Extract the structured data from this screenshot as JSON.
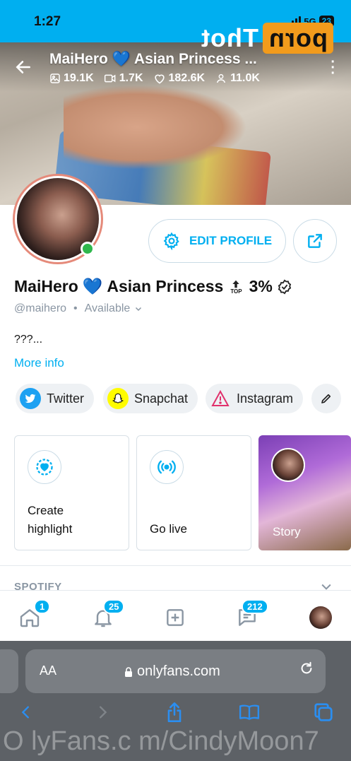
{
  "status_bar": {
    "time": "1:27",
    "network": "5G",
    "battery": "23"
  },
  "watermark": {
    "logo_box": "porn",
    "logo_plain": "Thot",
    "footer_text": "O lyFans.c m/CindyMoon7"
  },
  "cover": {
    "title_name": "MaiHero",
    "title_heart": "💙",
    "title_rest": "Asian Princess",
    "title_ellipsis": "...",
    "stats": {
      "photos": "19.1K",
      "videos": "1.7K",
      "likes": "182.6K",
      "fans": "11.0K"
    }
  },
  "profile": {
    "name": "MaiHero",
    "heart": "💙",
    "name_rest": "Asian Princess",
    "top_label": "TOP",
    "top_percent": "3%",
    "handle": "@maihero",
    "separator": "•",
    "availability": "Available",
    "bio": "???...",
    "more_info": "More info",
    "edit_profile": "EDIT PROFILE"
  },
  "socials": [
    {
      "label": "Twitter",
      "color": "#1da1f2"
    },
    {
      "label": "Snapchat",
      "color": "#fffc00"
    },
    {
      "label": "Instagram",
      "color": "#e1306c"
    }
  ],
  "cards": {
    "highlight_line1": "Create",
    "highlight_line2": "highlight",
    "go_live": "Go live",
    "story": "Story"
  },
  "section": {
    "spotify": "SPOTIFY"
  },
  "bottom_nav": {
    "notifications_badge": "1",
    "bell_badge": "25",
    "messages_badge": "212"
  },
  "browser": {
    "aa": "AA",
    "url": "onlyfans.com"
  },
  "colors": {
    "brand": "#00aff0",
    "online": "#2fb74c",
    "muted": "#8a96a3"
  }
}
